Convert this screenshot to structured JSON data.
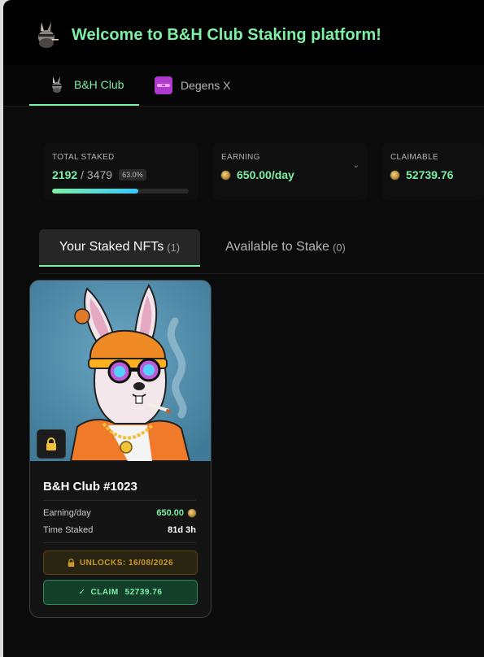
{
  "header": {
    "title": "Welcome to B&H Club Staking platform!",
    "logo_icon": "rabbit-logo-icon"
  },
  "collection_tabs": [
    {
      "label": "B&H Club",
      "active": true,
      "icon": "rabbit-avatar-icon"
    },
    {
      "label": "Degens X",
      "active": false,
      "icon": "degens-x-icon"
    }
  ],
  "stats": {
    "total_staked": {
      "label": "TOTAL STAKED",
      "value": "2192",
      "total": "/ 3479",
      "percent": "63.0%",
      "progress": 0.63
    },
    "earning": {
      "label": "EARNING",
      "value": "650.00/day"
    },
    "claimable": {
      "label": "CLAIMABLE",
      "value": "52739.76"
    }
  },
  "nft_tabs": {
    "staked": {
      "label": "Your Staked NFTs",
      "count": "(1)"
    },
    "available": {
      "label": "Available to Stake",
      "count": "(0)"
    }
  },
  "card": {
    "name": "B&H Club #1023",
    "earning_label": "Earning/day",
    "earning_value": "650.00",
    "time_label": "Time Staked",
    "time_value": "81d 3h",
    "unlock_label": "UNLOCKS: 16/08/2026",
    "claim_label": "CLAIM",
    "claim_value": "52739.76"
  },
  "colors": {
    "accent": "#7ef0a5",
    "gold": "#c99a2e",
    "background": "#0b0b0b"
  }
}
